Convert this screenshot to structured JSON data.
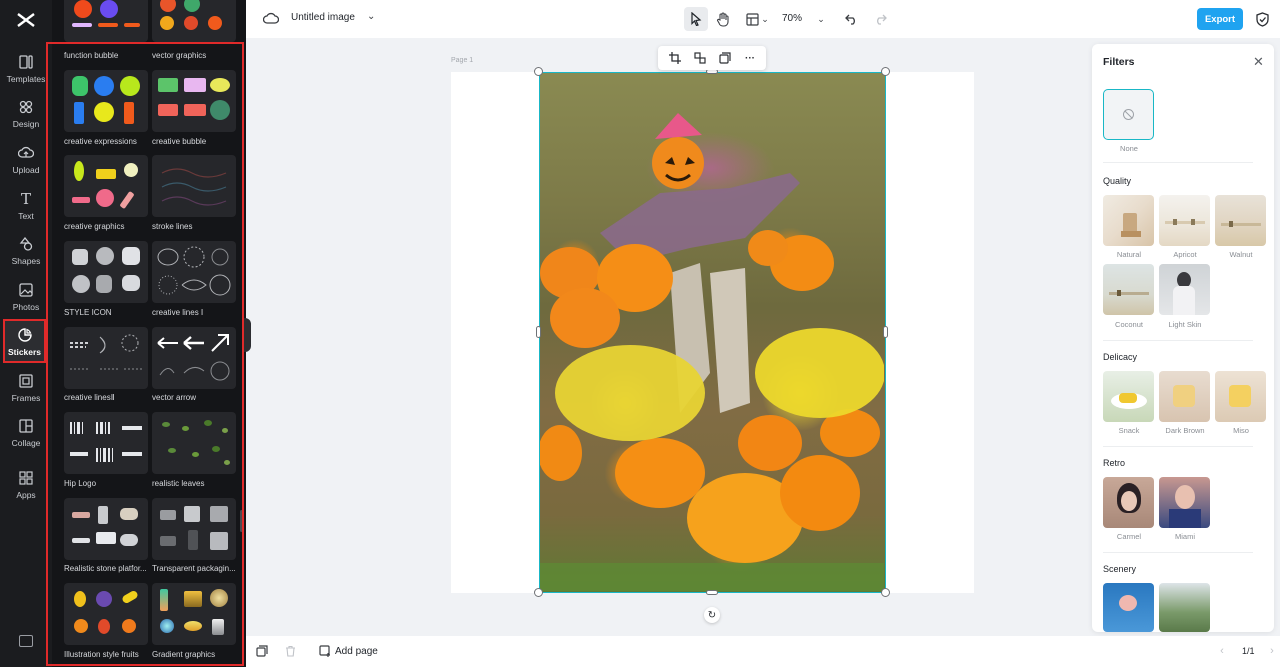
{
  "rail": {
    "items": [
      {
        "label": "Templates",
        "icon": "templates-icon"
      },
      {
        "label": "Design",
        "icon": "design-icon"
      },
      {
        "label": "Upload",
        "icon": "upload-icon"
      },
      {
        "label": "Text",
        "icon": "text-icon"
      },
      {
        "label": "Shapes",
        "icon": "shapes-icon"
      },
      {
        "label": "Photos",
        "icon": "photos-icon"
      },
      {
        "label": "Stickers",
        "icon": "stickers-icon",
        "active": true
      },
      {
        "label": "Frames",
        "icon": "frames-icon"
      },
      {
        "label": "Collage",
        "icon": "collage-icon"
      },
      {
        "label": "Apps",
        "icon": "apps-icon"
      }
    ]
  },
  "stickers": {
    "categories": [
      "function bubble",
      "vector graphics",
      "creative expressions",
      "creative bubble",
      "creative graphics",
      "stroke lines",
      "STYLE ICON",
      "creative lines Ⅰ",
      "creative linesⅡ",
      "vector arrow",
      "Hip Logo",
      "realistic leaves",
      "Realistic stone platfor...",
      "Transparent packagin...",
      "Illustration style fruits",
      "Gradient graphics"
    ]
  },
  "topbar": {
    "title": "Untitled image",
    "zoom": "70%",
    "export_label": "Export"
  },
  "canvas": {
    "page_label": "Page 1"
  },
  "filters": {
    "title": "Filters",
    "none_label": "None",
    "sections": [
      {
        "title": "Quality",
        "items": [
          "Natural",
          "Apricot",
          "Walnut",
          "Coconut",
          "Light Skin"
        ]
      },
      {
        "title": "Delicacy",
        "items": [
          "Snack",
          "Dark Brown",
          "Miso"
        ]
      },
      {
        "title": "Retro",
        "items": [
          "Carmel",
          "Miami"
        ]
      },
      {
        "title": "Scenery",
        "items": []
      }
    ]
  },
  "bottombar": {
    "add_page_label": "Add page",
    "page_indicator": "1/1"
  },
  "colors": {
    "accent": "#1fa3f0",
    "selection": "#19b7c6",
    "highlight": "#e02a2a"
  }
}
